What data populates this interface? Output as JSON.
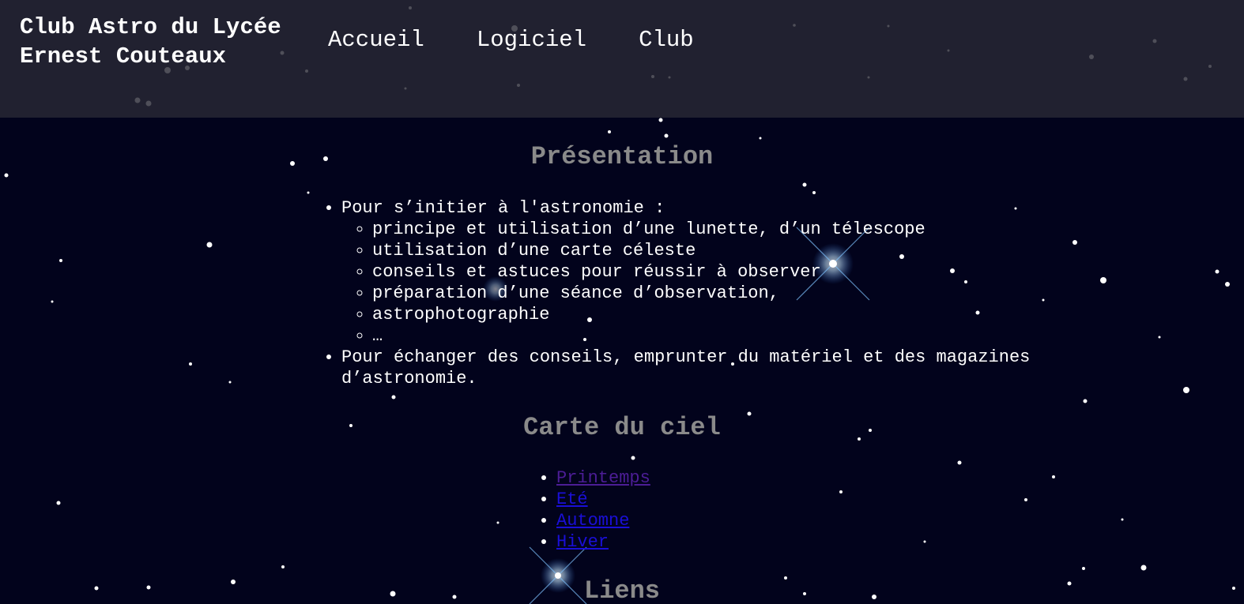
{
  "header": {
    "site_title_line1": "Club Astro du Lycée",
    "site_title_line2": "Ernest Couteaux",
    "nav": [
      {
        "label": "Accueil"
      },
      {
        "label": "Logiciel"
      },
      {
        "label": "Club"
      }
    ]
  },
  "presentation": {
    "title": "Présentation",
    "item1": "Pour s’initier à l'astronomie :",
    "subitems": [
      "principe et utilisation d’une lunette, d’un télescope",
      "utilisation d’une carte céleste",
      "conseils et astuces pour réussir à observer",
      "préparation d’une séance d’observation,",
      "astrophotographie",
      "…"
    ],
    "item2": "Pour échanger des conseils, emprunter du matériel et des magazines d’astronomie."
  },
  "carte": {
    "title": "Carte du ciel",
    "links": [
      "Printemps",
      "Eté",
      "Automne",
      "Hiver"
    ]
  },
  "liens": {
    "title": "Liens"
  },
  "colors": {
    "background": "#02031c",
    "header_bg": "#28283a",
    "section_title": "#8a8a8a",
    "link": "#1a0fd6",
    "visited_link": "#4c1d96"
  }
}
